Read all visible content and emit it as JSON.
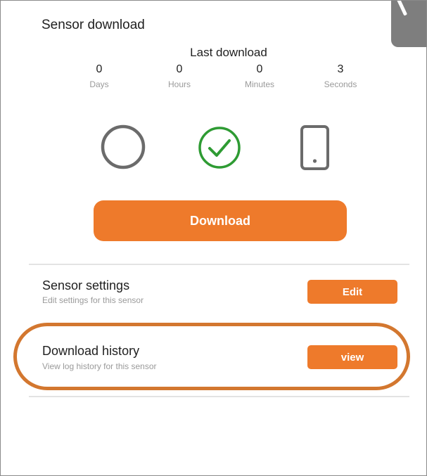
{
  "header": {
    "title": "Sensor download",
    "last_download_label": "Last download"
  },
  "counters": [
    {
      "value": "0",
      "unit": "Days"
    },
    {
      "value": "0",
      "unit": "Hours"
    },
    {
      "value": "0",
      "unit": "Minutes"
    },
    {
      "value": "3",
      "unit": "Seconds"
    }
  ],
  "status_icons": [
    "empty-circle-icon",
    "check-circle-icon",
    "phone-icon"
  ],
  "colors": {
    "accent": "#ee7a2b",
    "success": "#2e9b33",
    "icon_gray": "#6b6b6b",
    "highlight": "#d3772f"
  },
  "download_button": {
    "label": "Download"
  },
  "settings": {
    "title": "Sensor settings",
    "subtitle": "Edit settings for this sensor",
    "button_label": "Edit"
  },
  "history": {
    "title": "Download history",
    "subtitle": "View log history for this sensor",
    "button_label": "view"
  }
}
